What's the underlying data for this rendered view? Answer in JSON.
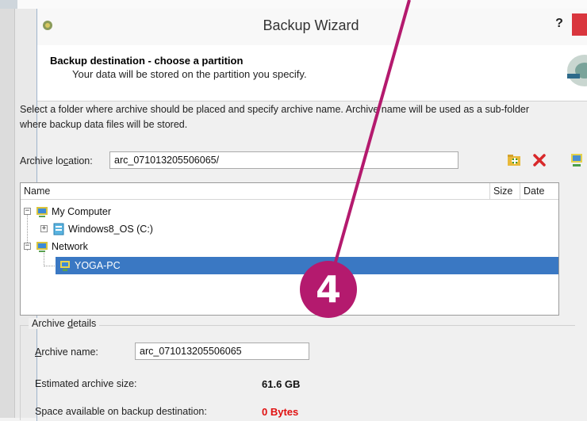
{
  "window": {
    "title": "Backup Wizard",
    "help_label": "?"
  },
  "header": {
    "title": "Backup destination - choose a partition",
    "subtitle": "Your data will be stored on the partition you specify."
  },
  "instructions": "Select a folder where archive should be placed and specify archive name. Archive name will be used as a sub-folder where backup data files will be stored.",
  "archive_location": {
    "label": "Archive location:",
    "value": "arc_071013205506065/"
  },
  "toolbar": {
    "new_folder_icon": "new-folder-icon",
    "delete_icon": "delete-x-icon",
    "network_icon": "network-drive-icon"
  },
  "tree": {
    "columns": [
      "Name",
      "Size",
      "Date"
    ],
    "items": [
      {
        "label": "My Computer",
        "icon": "computer-icon",
        "expander": "−"
      },
      {
        "label": "Windows8_OS (C:)",
        "icon": "drive-icon",
        "expander": "+"
      },
      {
        "label": "Network",
        "icon": "network-icon",
        "expander": "−"
      },
      {
        "label": "YOGA-PC",
        "icon": "pc-icon",
        "selected": true
      }
    ]
  },
  "details": {
    "group_label": "Archive details",
    "name_label": "Archive name:",
    "name_value": "arc_071013205506065",
    "size_label": "Estimated archive size:",
    "size_value": "61.6 GB",
    "space_label": "Space available on backup destination:",
    "space_value": "0 Bytes"
  },
  "annotation": {
    "marker_number": "4",
    "marker_color": "#b41a6e"
  },
  "colors": {
    "selection": "#3a78c3",
    "close": "#d9363e",
    "error_text": "#e01010"
  }
}
